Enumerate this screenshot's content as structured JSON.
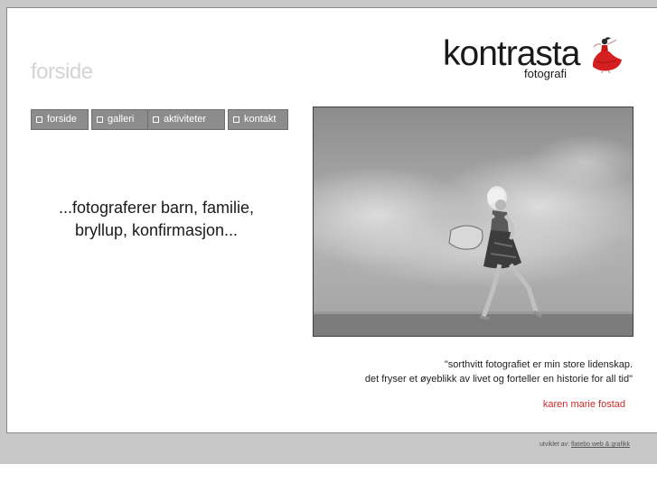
{
  "page": {
    "title": "forside"
  },
  "logo": {
    "name": "kontrasta",
    "subtitle": "fotografi",
    "figure_icon": "dancer-red-dress-icon",
    "accent": "#d42020"
  },
  "nav": {
    "items": [
      {
        "label": "forside",
        "bullet_icon": "square-bullet-icon"
      },
      {
        "label": "galleri",
        "bullet_icon": "square-bullet-icon"
      },
      {
        "label": "aktiviteter",
        "bullet_icon": "square-bullet-icon"
      },
      {
        "label": "kontakt",
        "bullet_icon": "square-bullet-icon"
      }
    ],
    "background": "#8c8c8c"
  },
  "tagline": {
    "line1": "...fotograferer barn, familie,",
    "line2": "bryllup, konfirmasjon..."
  },
  "quote": {
    "line1": "\"sorthvitt fotografiet er min store lidenskap.",
    "line2": "det fryser et øyeblikk av livet og forteller en historie for all tid\""
  },
  "author": {
    "name": "karen marie fostad",
    "color": "#cc2a2a"
  },
  "footer": {
    "prefix": "utviklet av:",
    "link": "flatebo web & grafikk"
  }
}
